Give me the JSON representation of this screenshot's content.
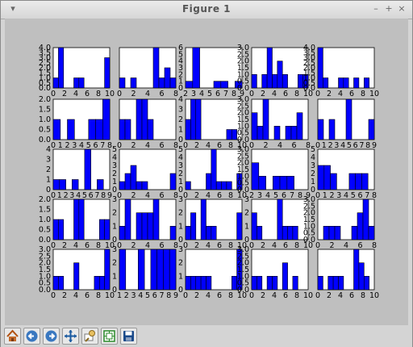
{
  "window": {
    "title": "Figure 1"
  },
  "titlebar_buttons": {
    "menu": "▾",
    "minimize": "–",
    "maximize": "+",
    "close": "×"
  },
  "toolbar": {
    "tools": [
      {
        "name": "home-tool",
        "icon": "home-icon"
      },
      {
        "name": "back-tool",
        "icon": "arrow-left-icon"
      },
      {
        "name": "forward-tool",
        "icon": "arrow-right-icon"
      },
      {
        "name": "pan-tool",
        "icon": "move-icon"
      },
      {
        "name": "zoom-tool",
        "icon": "zoom-rect-icon"
      },
      {
        "name": "configure-subplots-tool",
        "icon": "subplots-icon"
      },
      {
        "name": "save-tool",
        "icon": "floppy-icon"
      }
    ]
  },
  "colors": {
    "bar": "#0000ff",
    "plot_bg": "#ffffff",
    "figure_bg": "#bfbfbf"
  },
  "chart_data": [
    {
      "type": "bar",
      "x": [
        0,
        1,
        2,
        3,
        4,
        5,
        6,
        7,
        8,
        9,
        10
      ],
      "values": [
        1,
        4,
        0,
        0,
        1,
        1,
        0,
        0,
        0,
        0,
        3
      ],
      "xticks": [
        "0",
        "2",
        "4",
        "6",
        "8",
        "10"
      ],
      "yticks": [
        "0.0",
        "0.5",
        "1.0",
        "1.5",
        "2.0",
        "2.5",
        "3.0",
        "3.5",
        "4.0"
      ],
      "ylim": [
        0,
        4
      ]
    },
    {
      "type": "bar",
      "x": [
        0,
        1,
        2,
        3,
        4,
        5,
        6,
        7,
        8,
        9
      ],
      "values": [
        1,
        0,
        1,
        0,
        0,
        0,
        4,
        1,
        2,
        1
      ],
      "xticks": [
        "0",
        "2",
        "4",
        "6",
        "8"
      ],
      "yticks": [],
      "ylim": [
        0,
        4
      ]
    },
    {
      "type": "bar",
      "x": [
        2,
        3,
        4,
        5,
        6,
        7,
        8,
        9
      ],
      "values": [
        1,
        6,
        0,
        0,
        1,
        1,
        0,
        1
      ],
      "xticks": [
        "2",
        "3",
        "4",
        "5",
        "6",
        "7",
        "8",
        "9"
      ],
      "yticks": [
        "0",
        "1",
        "2",
        "3",
        "4",
        "5",
        "6"
      ],
      "ylim": [
        0,
        6
      ]
    },
    {
      "type": "bar",
      "x": [
        0,
        1,
        2,
        3,
        4,
        5,
        6,
        7,
        8,
        9,
        10
      ],
      "values": [
        1,
        0,
        1,
        3,
        1,
        2,
        1,
        0,
        0,
        1,
        1
      ],
      "xticks": [
        "0",
        "2",
        "4",
        "6",
        "8",
        "10"
      ],
      "yticks": [
        "0.0",
        "0.5",
        "1.0",
        "1.5",
        "2.0",
        "2.5",
        "3.0"
      ],
      "ylim": [
        0,
        3
      ]
    },
    {
      "type": "bar",
      "x": [
        0,
        1,
        2,
        3,
        4,
        5,
        6,
        7,
        8,
        9,
        10
      ],
      "values": [
        4,
        1,
        0,
        0,
        1,
        1,
        0,
        1,
        0,
        1,
        0
      ],
      "xticks": [
        "0",
        "2",
        "4",
        "6",
        "8",
        "10"
      ],
      "yticks": [
        "0.0",
        "0.5",
        "1.0",
        "1.5",
        "2.0",
        "2.5",
        "3.0",
        "3.5",
        "4.0"
      ],
      "ylim": [
        0,
        4
      ]
    },
    {
      "type": "bar",
      "x": [
        1,
        2,
        3,
        4,
        5,
        6,
        7,
        8
      ],
      "values": [
        1,
        0,
        1,
        0,
        0,
        1,
        1,
        2
      ],
      "xticks": [
        "0",
        "1",
        "2",
        "3",
        "4",
        "5",
        "6",
        "7",
        "8"
      ],
      "yticks": [
        "0.0",
        "0.5",
        "1.0",
        "1.5",
        "2.0"
      ],
      "ylim": [
        0,
        2
      ]
    },
    {
      "type": "bar",
      "x": [
        0,
        1,
        2,
        3,
        4,
        5,
        6,
        7,
        8,
        9
      ],
      "values": [
        1,
        1,
        0,
        2,
        2,
        1,
        0,
        0,
        0,
        0
      ],
      "xticks": [
        "0",
        "2",
        "4",
        "6",
        "8"
      ],
      "yticks": [],
      "ylim": [
        0,
        2
      ]
    },
    {
      "type": "bar",
      "x": [
        0,
        1,
        2,
        3,
        4,
        5,
        6,
        7,
        8,
        9,
        10
      ],
      "values": [
        2,
        4,
        4,
        0,
        0,
        0,
        0,
        0,
        1,
        1,
        0
      ],
      "xticks": [
        "0",
        "2",
        "4",
        "6",
        "8",
        "10"
      ],
      "yticks": [
        "0",
        "1",
        "2",
        "3",
        "4"
      ],
      "ylim": [
        0,
        4
      ]
    },
    {
      "type": "bar",
      "x": [
        0,
        1,
        2,
        3,
        4,
        5,
        6,
        7,
        8,
        9
      ],
      "values": [
        2,
        1,
        3,
        0,
        1,
        0,
        1,
        1,
        2,
        0
      ],
      "xticks": [
        "0",
        "2",
        "4",
        "6",
        "8"
      ],
      "yticks": [
        "0.0",
        "0.5",
        "1.0",
        "1.5",
        "2.0",
        "2.5",
        "3.0"
      ],
      "ylim": [
        0,
        3
      ]
    },
    {
      "type": "bar",
      "x": [
        0,
        1,
        2,
        3,
        4,
        5,
        6,
        7,
        8,
        9
      ],
      "values": [
        1,
        0,
        1,
        0,
        0,
        2,
        0,
        0,
        0,
        1
      ],
      "xticks": [
        "0",
        "1",
        "2",
        "3",
        "4",
        "5",
        "6",
        "7",
        "8",
        "9"
      ],
      "yticks": [],
      "ylim": [
        0,
        2
      ]
    },
    {
      "type": "bar",
      "x": [
        1,
        2,
        3,
        4,
        5,
        6,
        7,
        8,
        9
      ],
      "values": [
        1,
        1,
        0,
        1,
        0,
        4,
        0,
        1,
        0
      ],
      "xticks": [
        "0",
        "1",
        "2",
        "3",
        "4",
        "5",
        "6",
        "7",
        "8",
        "9"
      ],
      "yticks": [
        "0",
        "1",
        "2",
        "3",
        "4"
      ],
      "ylim": [
        0,
        4
      ]
    },
    {
      "type": "bar",
      "x": [
        0,
        1,
        2,
        3,
        4,
        5,
        6,
        7,
        8,
        9
      ],
      "values": [
        1,
        2,
        3,
        1,
        1,
        0,
        0,
        0,
        0,
        2
      ],
      "xticks": [
        "0",
        "2",
        "4",
        "6",
        "8"
      ],
      "yticks": [
        "0",
        "1",
        "2",
        "3",
        "4",
        "5"
      ],
      "ylim": [
        0,
        5
      ]
    },
    {
      "type": "bar",
      "x": [
        0,
        1,
        2,
        3,
        4,
        5,
        6,
        7,
        8,
        9,
        10
      ],
      "values": [
        1,
        0,
        0,
        0,
        2,
        5,
        1,
        1,
        1,
        0,
        2
      ],
      "xticks": [
        "0",
        "2",
        "4",
        "6",
        "8",
        "10"
      ],
      "yticks": [
        "0",
        "1",
        "2",
        "3",
        "4",
        "5"
      ],
      "ylim": [
        0,
        5
      ]
    },
    {
      "type": "bar",
      "x": [
        2,
        3,
        4,
        5,
        6,
        7,
        8,
        9
      ],
      "values": [
        2,
        1,
        0,
        1,
        1,
        1,
        0,
        0
      ],
      "xticks": [
        "2",
        "3",
        "4",
        "5",
        "6",
        "7",
        "8",
        "9"
      ],
      "yticks": [
        "0.0",
        "0.5",
        "1.0",
        "1.5",
        "2.0",
        "2.5",
        "3.0"
      ],
      "ylim": [
        0,
        3
      ]
    },
    {
      "type": "bar",
      "x": [
        0,
        1,
        2,
        3,
        4,
        5,
        6,
        7,
        8
      ],
      "values": [
        3,
        3,
        2,
        0,
        0,
        2,
        2,
        2,
        0
      ],
      "xticks": [
        "0",
        "1",
        "2",
        "3",
        "4",
        "5",
        "6",
        "7",
        "8"
      ],
      "yticks": [
        "0",
        "1",
        "2",
        "3",
        "4",
        "5"
      ],
      "ylim": [
        0,
        5
      ]
    },
    {
      "type": "bar",
      "x": [
        0,
        1,
        2,
        3,
        4,
        5,
        6,
        7,
        8,
        9,
        10
      ],
      "values": [
        1,
        1,
        0,
        0,
        2,
        2,
        0,
        0,
        0,
        1,
        1
      ],
      "xticks": [
        "0",
        "2",
        "4",
        "6",
        "8",
        "10"
      ],
      "yticks": [
        "0.0",
        "0.5",
        "1.0",
        "1.5",
        "2.0"
      ],
      "ylim": [
        0,
        2
      ]
    },
    {
      "type": "bar",
      "x": [
        0,
        1,
        2,
        3,
        4,
        5,
        6,
        7,
        8,
        9
      ],
      "values": [
        1,
        3,
        0,
        2,
        2,
        2,
        3,
        0,
        0,
        1
      ],
      "xticks": [
        "0",
        "2",
        "4",
        "6",
        "8"
      ],
      "yticks": [
        "0",
        "1",
        "2",
        "3"
      ],
      "ylim": [
        0,
        3
      ]
    },
    {
      "type": "bar",
      "x": [
        0,
        1,
        2,
        3,
        4,
        5,
        6,
        7,
        8,
        9,
        10
      ],
      "values": [
        1,
        2,
        0,
        3,
        1,
        1,
        0,
        0,
        0,
        0,
        2
      ],
      "xticks": [
        "0",
        "2",
        "4",
        "6",
        "8",
        "10"
      ],
      "yticks": [
        "0",
        "1",
        "2",
        "3"
      ],
      "ylim": [
        0,
        3
      ]
    },
    {
      "type": "bar",
      "x": [
        0,
        1,
        2,
        3,
        4,
        5,
        6,
        7,
        8,
        9,
        10
      ],
      "values": [
        2,
        1,
        0,
        0,
        0,
        3,
        1,
        1,
        1,
        0,
        0
      ],
      "xticks": [
        "0",
        "2",
        "4",
        "6",
        "8",
        "10"
      ],
      "yticks": [
        "0",
        "1",
        "2",
        "3"
      ],
      "ylim": [
        0,
        3
      ]
    },
    {
      "type": "bar",
      "x": [
        0,
        1,
        2,
        3,
        4,
        5,
        6,
        7,
        8,
        9
      ],
      "values": [
        0,
        1,
        1,
        1,
        0,
        0,
        1,
        2,
        3,
        1
      ],
      "xticks": [
        "0",
        "2",
        "4",
        "6",
        "8"
      ],
      "yticks": [
        "0.0",
        "0.5",
        "1.0",
        "1.5",
        "2.0",
        "2.5",
        "3.0"
      ],
      "ylim": [
        0,
        3
      ]
    },
    {
      "type": "bar",
      "x": [
        0,
        1,
        2,
        3,
        4,
        5,
        6,
        7,
        8,
        9,
        10
      ],
      "values": [
        1,
        1,
        0,
        0,
        2,
        0,
        0,
        0,
        1,
        1,
        3
      ],
      "xticks": [
        "0",
        "2",
        "4",
        "6",
        "8",
        "10"
      ],
      "yticks": [
        "0.0",
        "0.5",
        "1.0",
        "1.5",
        "2.0",
        "2.5",
        "3.0"
      ],
      "ylim": [
        0,
        3
      ]
    },
    {
      "type": "bar",
      "x": [
        1,
        2,
        3,
        4,
        5,
        6,
        7,
        8,
        9
      ],
      "values": [
        1,
        0,
        0,
        1,
        0,
        1,
        1,
        1,
        1
      ],
      "xticks": [
        "1",
        "2",
        "3",
        "4",
        "5",
        "6",
        "7",
        "8",
        "9"
      ],
      "yticks": [
        "0",
        "1",
        "2",
        "3"
      ],
      "ylim": [
        0,
        1
      ]
    },
    {
      "type": "bar",
      "x": [
        0,
        1,
        2,
        3,
        4,
        5,
        6,
        7,
        8,
        9,
        10
      ],
      "values": [
        1,
        1,
        1,
        1,
        1,
        0,
        0,
        0,
        0,
        1,
        3
      ],
      "xticks": [
        "0",
        "2",
        "4",
        "6",
        "8",
        "10"
      ],
      "yticks": [
        "0",
        "1",
        "2",
        "3"
      ],
      "ylim": [
        0,
        3
      ]
    },
    {
      "type": "bar",
      "x": [
        0,
        1,
        2,
        3,
        4,
        5,
        6,
        7,
        8,
        9,
        10
      ],
      "values": [
        1,
        1,
        0,
        1,
        1,
        0,
        2,
        0,
        1,
        0,
        0
      ],
      "xticks": [
        "0",
        "2",
        "4",
        "6",
        "8",
        "10"
      ],
      "yticks": [
        "0.0",
        "0.5",
        "1.0",
        "1.5",
        "2.0",
        "2.5",
        "3.0"
      ],
      "ylim": [
        0,
        3
      ]
    },
    {
      "type": "bar",
      "x": [
        0,
        1,
        2,
        3,
        4,
        5,
        6,
        7,
        8,
        9,
        10
      ],
      "values": [
        1,
        0,
        1,
        1,
        1,
        0,
        0,
        3,
        2,
        1,
        0
      ],
      "xticks": [
        "0",
        "2",
        "4",
        "6",
        "8",
        "10"
      ],
      "yticks": [],
      "ylim": [
        0,
        3
      ]
    }
  ]
}
